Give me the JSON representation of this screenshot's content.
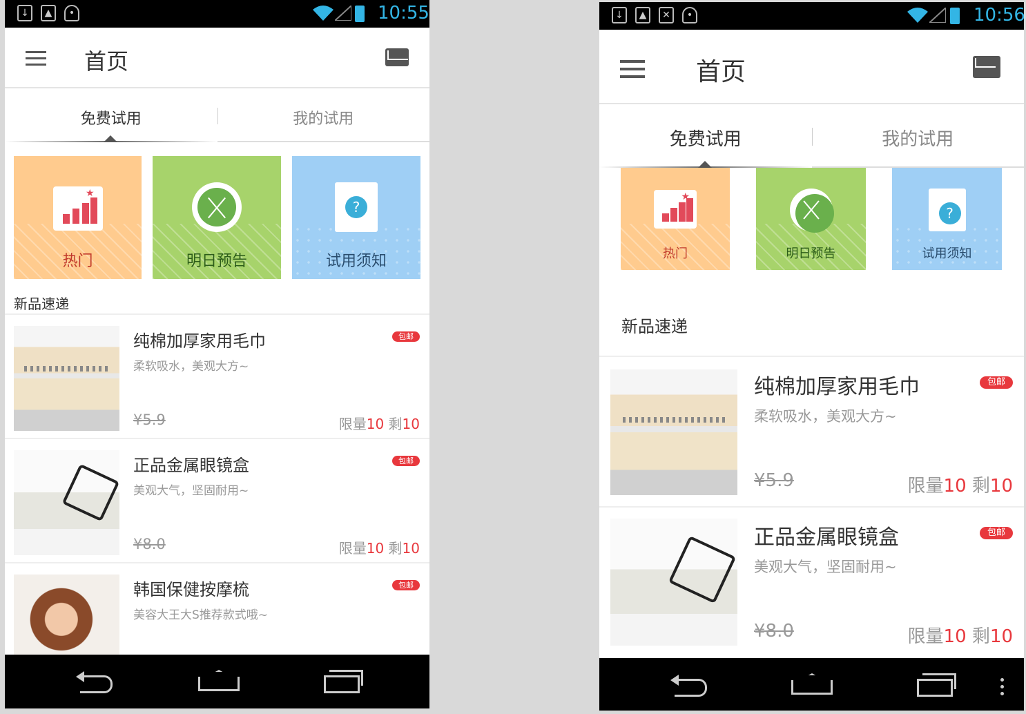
{
  "screens": [
    {
      "status": {
        "time": "10:55"
      },
      "appbar": {
        "title": "首页"
      },
      "tabs": [
        {
          "label": "免费试用"
        },
        {
          "label": "我的试用"
        }
      ],
      "categories": [
        {
          "label": "热门"
        },
        {
          "label": "明日预告"
        },
        {
          "label": "试用须知"
        }
      ],
      "section_title": "新品速递",
      "products": [
        {
          "name": "纯棉加厚家用毛巾",
          "desc": "柔软吸水，美观大方~",
          "badge": "包邮",
          "price": "¥5.9",
          "limit_label": "限量",
          "limit": "10",
          "remain_label": "剩",
          "remain": "10"
        },
        {
          "name": "正品金属眼镜盒",
          "desc": "美观大气，坚固耐用~",
          "badge": "包邮",
          "price": "¥8.0",
          "limit_label": "限量",
          "limit": "10",
          "remain_label": "剩",
          "remain": "10"
        },
        {
          "name": "韩国保健按摩梳",
          "desc": "美容大王大S推荐款式哦~",
          "badge": "包邮"
        }
      ]
    },
    {
      "status": {
        "time": "10:56"
      },
      "appbar": {
        "title": "首页"
      },
      "tabs": [
        {
          "label": "免费试用"
        },
        {
          "label": "我的试用"
        }
      ],
      "categories": [
        {
          "label": "热门"
        },
        {
          "label": "明日预告"
        },
        {
          "label": "试用须知"
        }
      ],
      "section_title": "新品速递",
      "products": [
        {
          "name": "纯棉加厚家用毛巾",
          "desc": "柔软吸水，美观大方~",
          "badge": "包邮",
          "price": "¥5.9",
          "limit_label": "限量",
          "limit": "10",
          "remain_label": "剩",
          "remain": "10"
        },
        {
          "name": "正品金属眼镜盒",
          "desc": "美观大气，坚固耐用~",
          "badge": "包邮",
          "price": "¥8.0",
          "limit_label": "限量",
          "limit": "10",
          "remain_label": "剩",
          "remain": "10"
        }
      ]
    }
  ],
  "colors": {
    "accent_red": "#e8383d",
    "status_blue": "#33b5e5",
    "hot_bg": "#ffcb8e",
    "preview_bg": "#a7d36b",
    "notice_bg": "#9fcff5"
  }
}
